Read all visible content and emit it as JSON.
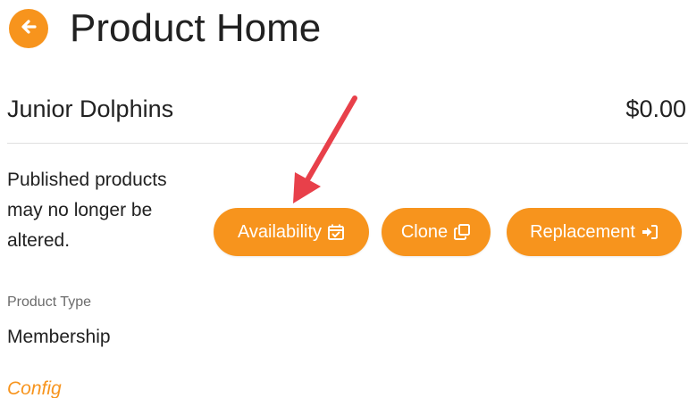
{
  "header": {
    "title": "Product Home",
    "back_icon": "arrow-left-icon"
  },
  "product": {
    "name": "Junior Dolphins",
    "price": "$0.00"
  },
  "notice": {
    "text": "Published products may no longer be altered."
  },
  "actions": {
    "availability_label": "Availability",
    "availability_icon": "calendar-check-icon",
    "clone_label": "Clone",
    "clone_icon": "copy-icon",
    "replacement_label": "Replacement",
    "replacement_icon": "sign-in-icon"
  },
  "details": {
    "type_label": "Product Type",
    "type_value": "Membership",
    "config_link": "Config"
  },
  "colors": {
    "accent": "#f7941d",
    "annotation_arrow": "#e8404a",
    "text": "#212121",
    "muted": "#6b6b6b"
  }
}
